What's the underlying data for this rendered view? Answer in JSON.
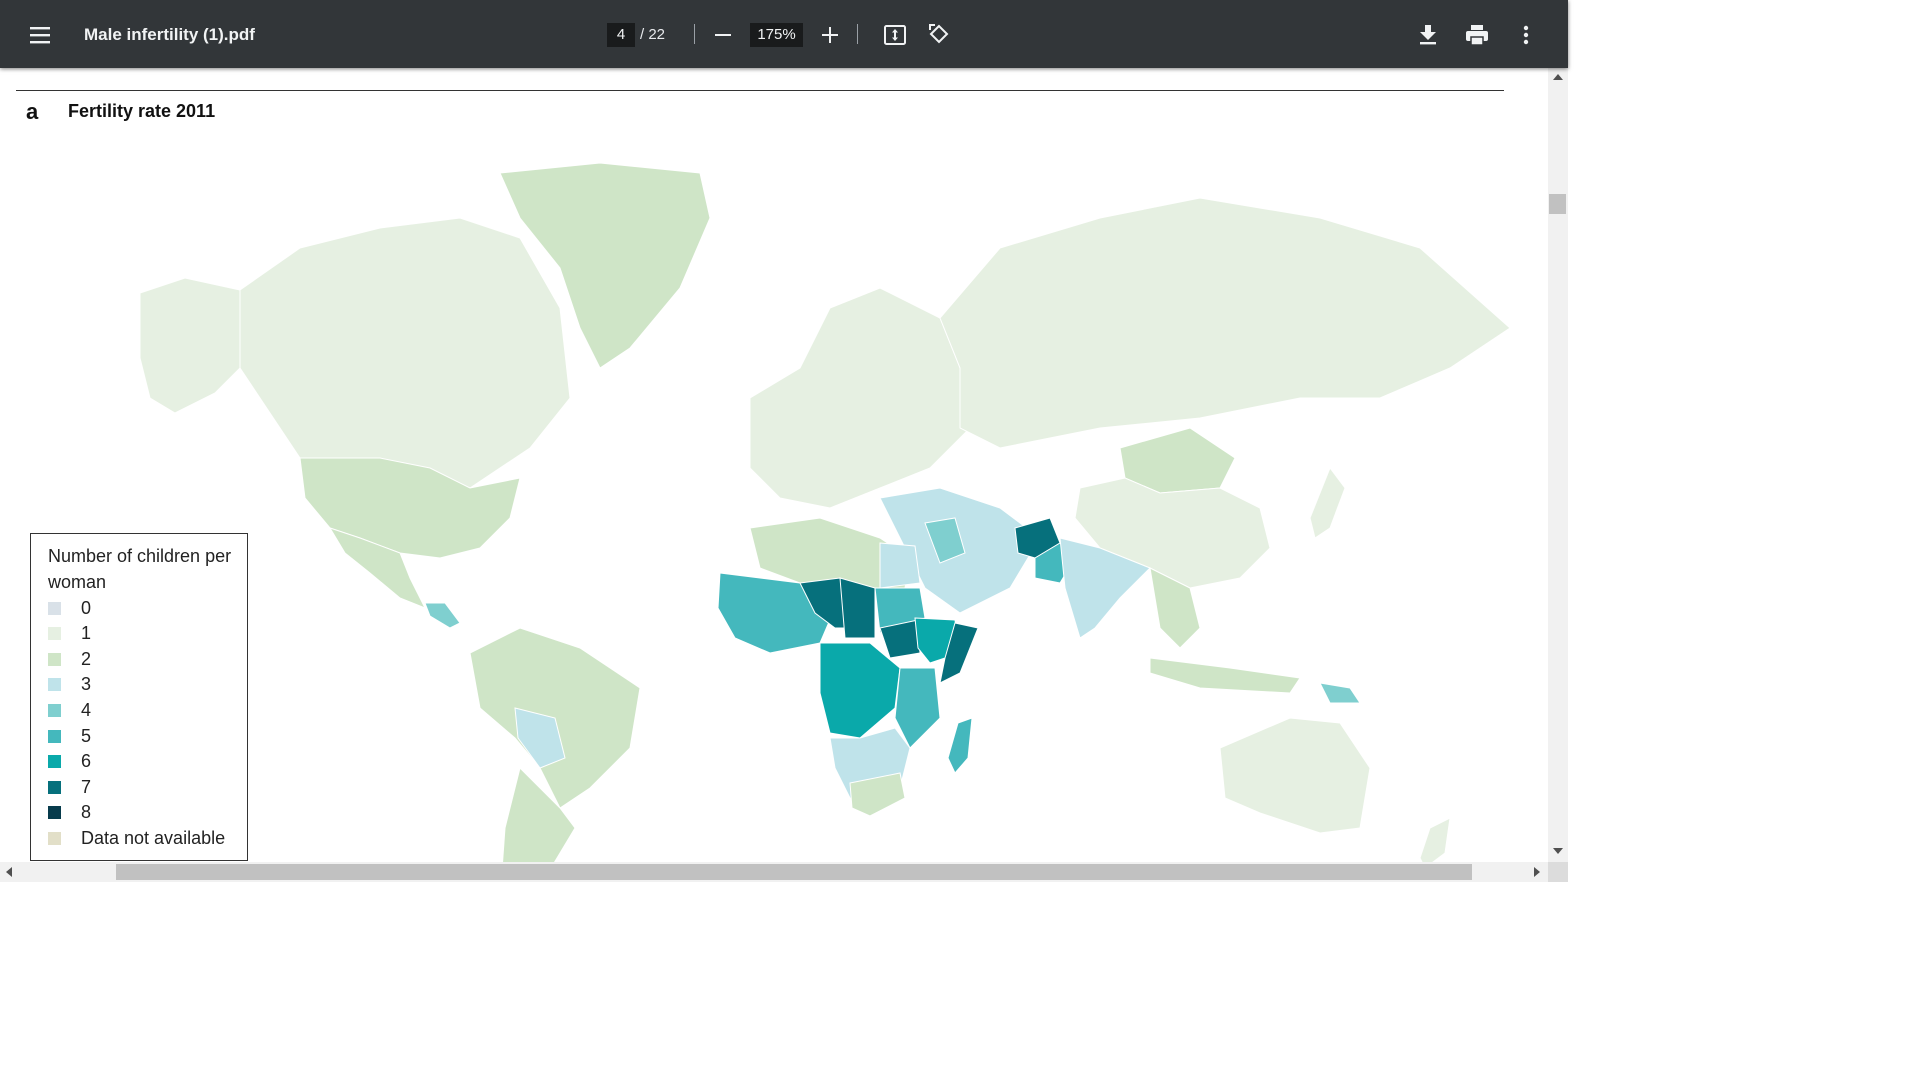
{
  "toolbar": {
    "menu_icon": "hamburger-menu-icon",
    "title": "Male infertility (1).pdf",
    "page_current": "4",
    "page_total": "/ 22",
    "zoom": "175%",
    "icons": {
      "zoom_out": "minus-icon",
      "zoom_in": "plus-icon",
      "fit": "fit-to-page-icon",
      "rotate": "rotate-counterclockwise-icon",
      "download": "download-icon",
      "print": "print-icon",
      "more": "more-vert-icon"
    }
  },
  "document": {
    "panel_letter": "a",
    "panel_title": "Fertility rate 2011",
    "legend": {
      "title": "Number of children per woman",
      "items": [
        {
          "label": "0",
          "color": "#d9e1e8"
        },
        {
          "label": "1",
          "color": "#e6f0e2"
        },
        {
          "label": "2",
          "color": "#cfe5c7"
        },
        {
          "label": "3",
          "color": "#bfe3ea"
        },
        {
          "label": "4",
          "color": "#7fcfcf"
        },
        {
          "label": "5",
          "color": "#44b8bd"
        },
        {
          "label": "6",
          "color": "#0aa9aa"
        },
        {
          "label": "7",
          "color": "#06707c"
        },
        {
          "label": "8",
          "color": "#073b4c"
        },
        {
          "label": "Data not available",
          "color": "#e2dfc8"
        }
      ]
    }
  },
  "scrollbars": {
    "vertical_position": 0.18,
    "horizontal_position": 0.07
  }
}
